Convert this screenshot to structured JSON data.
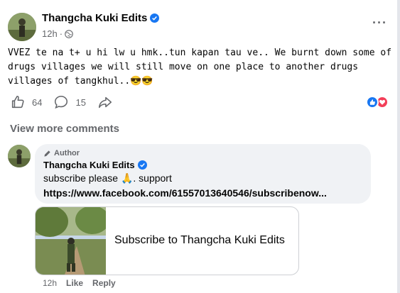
{
  "post": {
    "author": "Thangcha Kuki Edits",
    "time": "12h",
    "text": "VVEZ te na t+ u hi lw u hmk..tun kapan tau ve.. We burnt down some of\ndrugs villages we will still move on one place to another drugs\nvillages of tangkhul..😎😎",
    "likes": "64",
    "comments": "15",
    "more": "···"
  },
  "view_more_comments": "View more comments",
  "comment": {
    "badge": "Author",
    "author": "Thangcha Kuki Edits",
    "line1": "subscribe please 🙏. support",
    "link": "https://www.facebook.com/61557013640546/subscribenow...",
    "preview_title": "Subscribe to Thangcha Kuki Edits",
    "time": "12h",
    "like": "Like",
    "reply": "Reply"
  },
  "colors": {
    "accent": "#1877f2",
    "love": "#f33e58",
    "muted": "#65676b",
    "bubble": "#f0f2f5"
  },
  "icons": [
    "globe-icon",
    "verified-icon",
    "like-icon",
    "comment-icon",
    "share-icon",
    "more-icon",
    "pen-icon"
  ]
}
